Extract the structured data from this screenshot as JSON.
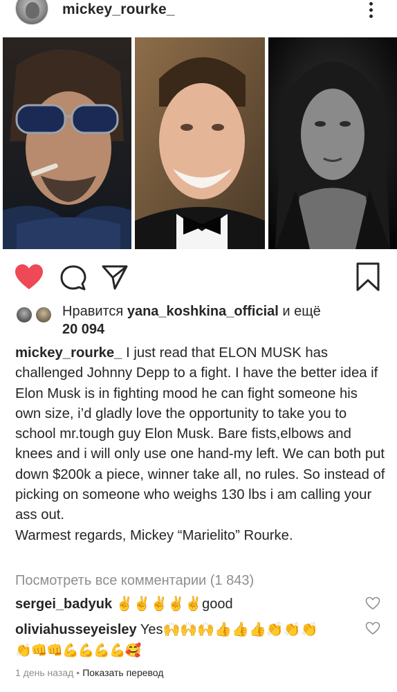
{
  "header": {
    "username": "mickey_rourke_"
  },
  "likes": {
    "prefix": "Нравится",
    "user": "yana_koshkina_official",
    "and_more": "и ещё",
    "count": "20 094"
  },
  "caption": {
    "username": "mickey_rourke_",
    "text": "I just read that ELON MUSK has challenged Johnny Depp to a fight. I have the better idea if Elon Musk is in fighting mood he can fight someone his own size, i’d gladly love the opportunity to take you to school mr.tough guy Elon Musk. Bare fists,elbows and knees and i will only use one hand-my left. We can both put down $200k a piece, winner take all, no rules. So instead of picking on someone who weighs 130 lbs i am calling your ass out.",
    "signoff": "Warmest regards, Mickey “Marielito” Rourke."
  },
  "comments": {
    "view_all": "Посмотреть все комментарии (1 843)",
    "items": [
      {
        "username": "sergei_badyuk",
        "text": "✌️✌️✌️✌️✌️good"
      },
      {
        "username": "oliviahusseyeisley",
        "text": "Yes🙌🙌🙌👍👍👍👏👏👏",
        "text2": "👏👊👊💪💪💪💪🥰"
      }
    ]
  },
  "meta": {
    "time": "1 день назад",
    "translate": "Показать перевод"
  },
  "icons": [
    "more-vertical-icon",
    "heart-filled-icon",
    "comment-icon",
    "share-icon",
    "bookmark-icon",
    "small-heart-icon"
  ],
  "colors": {
    "like_red": "#ed4956",
    "text": "#262626",
    "muted": "#8e8e8e"
  }
}
